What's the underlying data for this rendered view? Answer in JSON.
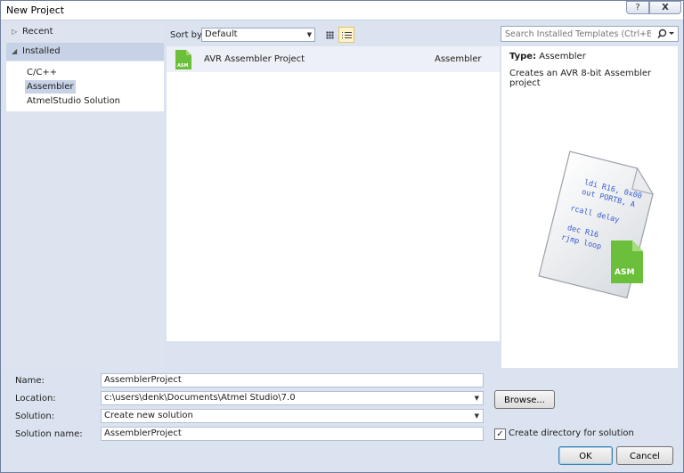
{
  "window": {
    "title": "New Project",
    "help_label": "?",
    "close_label": "X"
  },
  "tree": {
    "recent": "Recent",
    "installed": "Installed",
    "children": [
      "C/C++",
      "Assembler",
      "AtmelStudio Solution"
    ],
    "selected_index": 1
  },
  "sort": {
    "label": "Sort by:",
    "value": "Default"
  },
  "templates": [
    {
      "name": "AVR Assembler Project",
      "language": "Assembler",
      "icon": "asm-file-icon",
      "icon_label": "ASM"
    }
  ],
  "search": {
    "placeholder": "Search Installed Templates (Ctrl+E)"
  },
  "details": {
    "type_label": "Type:",
    "type_value": "Assembler",
    "description": "Creates an AVR 8-bit Assembler project",
    "preview_code": [
      "ldi R16, 0x00",
      "out PORTB, A",
      "rcall delay",
      "dec R16",
      "rjmp loop"
    ],
    "preview_badge": "ASM"
  },
  "form": {
    "name_label": "Name:",
    "name_value": "AssemblerProject",
    "location_label": "Location:",
    "location_value": "c:\\users\\denk\\Documents\\Atmel Studio\\7.0",
    "solution_label": "Solution:",
    "solution_value": "Create new solution",
    "solution_name_label": "Solution name:",
    "solution_name_value": "AssemblerProject",
    "browse_label": "Browse...",
    "create_dir_label": "Create directory for solution",
    "create_dir_checked": true,
    "ok_label": "OK",
    "cancel_label": "Cancel"
  },
  "colors": {
    "accent_green": "#6cbf3a",
    "selection": "#c7d2e6",
    "frame": "#dbe3f0"
  }
}
